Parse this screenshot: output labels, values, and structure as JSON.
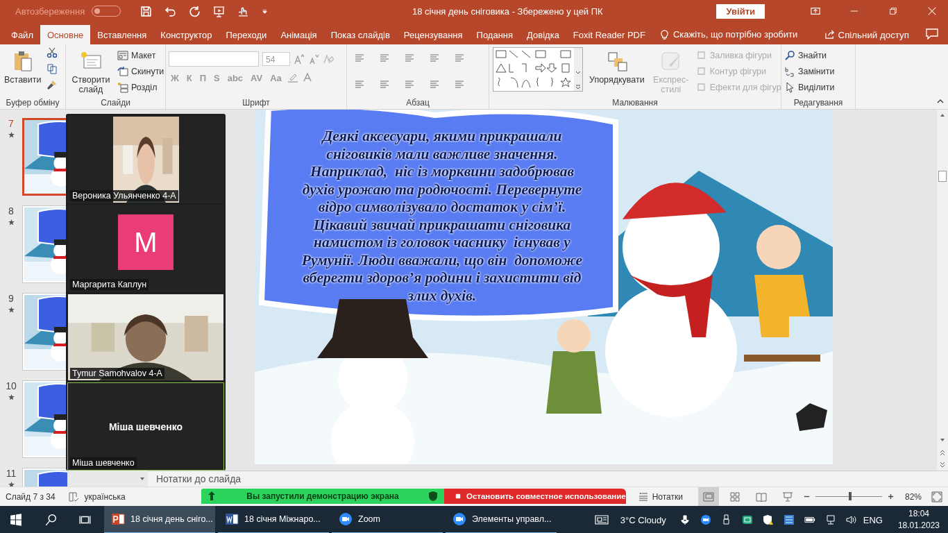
{
  "title_bar": {
    "autosave_label": "Автозбереження",
    "autosave_on": false,
    "title": "18 січня день сніговика  -  Збережено у цей ПК",
    "sign_in": "Увійти"
  },
  "tabs": [
    {
      "label": "Файл",
      "selected": false
    },
    {
      "label": "Основне",
      "selected": true
    },
    {
      "label": "Вставлення",
      "selected": false
    },
    {
      "label": "Конструктор",
      "selected": false
    },
    {
      "label": "Переходи",
      "selected": false
    },
    {
      "label": "Анімація",
      "selected": false
    },
    {
      "label": "Показ слайдів",
      "selected": false
    },
    {
      "label": "Рецензування",
      "selected": false
    },
    {
      "label": "Подання",
      "selected": false
    },
    {
      "label": "Довідка",
      "selected": false
    },
    {
      "label": "Foxit Reader PDF",
      "selected": false
    }
  ],
  "tell_me": "Скажіть, що потрібно зробити",
  "share": "Спільний доступ",
  "ribbon": {
    "clipboard": {
      "label": "Буфер обміну",
      "paste": "Вставити"
    },
    "slides": {
      "label": "Слайди",
      "new_slide": "Створити слайд",
      "layout": "Макет",
      "reset": "Скинути",
      "section": "Розділ"
    },
    "font": {
      "label": "Шрифт",
      "font_size": "54",
      "format_buttons": [
        "Ж",
        "К",
        "П",
        "S",
        "abc",
        "AV",
        "Aa"
      ]
    },
    "paragraph": {
      "label": "Абзац"
    },
    "drawing": {
      "label": "Малювання",
      "arrange": "Упорядкувати",
      "quick_styles": {
        "label": "Експрес-стилі",
        "disabled": true
      },
      "shape_buttons": [
        {
          "label": "Заливка фігури",
          "disabled": true
        },
        {
          "label": "Контур фігури",
          "disabled": true
        },
        {
          "label": "Ефекти для фігур",
          "disabled": true
        }
      ]
    },
    "editing": {
      "label": "Редагування",
      "find": "Знайти",
      "replace": "Замінити",
      "select": "Виділити"
    }
  },
  "slides": [
    {
      "number": "7",
      "selected": true
    },
    {
      "number": "8",
      "selected": false
    },
    {
      "number": "9",
      "selected": false
    },
    {
      "number": "10",
      "selected": false
    },
    {
      "number": "11",
      "selected": false
    }
  ],
  "slide_text": "Деякі аксесуари, якими прикрашали\nсніговиків мали важливе значення.\nНаприклад,  ніс із морквини задобрював\nдухів урожаю та родючості. Перевернуте\nвідро символізувало достаток у сім’ї.\nЦікавий звичай прикрашати сніговика\nнамистом із головок часнику  існував у\nРумунії. Люди вважали, що він  допоможе\nвберегти здоров’я родини і захистити від\nзлих духів.",
  "zoom_participants": [
    {
      "kind": "video",
      "name": "Вероника Ульянченко 4-А",
      "speaking": false
    },
    {
      "kind": "avatar",
      "initial": "M",
      "name": "Маргарита Каплун",
      "speaking": false
    },
    {
      "kind": "video",
      "name": "Tymur Samohvalov 4-A",
      "speaking": false
    },
    {
      "kind": "no_video",
      "display_name": "Міша шевченко",
      "name": "Міша шевченко",
      "speaking": true
    }
  ],
  "notes_placeholder": "Нотатки до слайда",
  "status_bar": {
    "slide_info": "Слайд 7 з 34",
    "language": "українська",
    "notes": "Нотатки",
    "views": [
      {
        "kind": "normal",
        "selected": true
      },
      {
        "kind": "sorter",
        "selected": false
      },
      {
        "kind": "reading",
        "selected": false
      },
      {
        "kind": "slideshow",
        "selected": false
      }
    ],
    "zoom": {
      "level": 0.52,
      "reading": "82%"
    }
  },
  "share_banner": {
    "message": "Вы запустили демонстрацию экрана",
    "stop": "Остановить совместное использование"
  },
  "taskbar": {
    "apps": [
      {
        "kind": "powerpoint",
        "label": "18 січня день сніго...",
        "selected": true
      },
      {
        "kind": "word",
        "label": "18 січня  Міжнаро...",
        "selected": false
      },
      {
        "kind": "zoom",
        "label": "Zoom",
        "selected": false
      },
      {
        "kind": "zoom",
        "label": "Элементы управл...",
        "selected": false
      }
    ],
    "weather": "3°C  Cloudy",
    "language": "ENG",
    "time": "18:04",
    "date": "18.01.2023"
  }
}
